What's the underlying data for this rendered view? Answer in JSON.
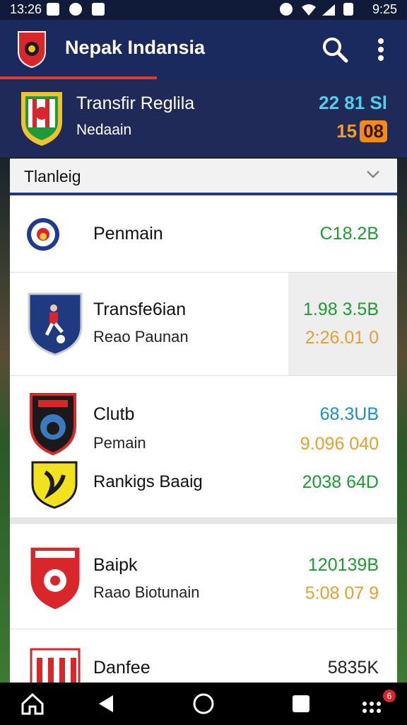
{
  "status": {
    "time_left": "13:26",
    "time_right": "9:25"
  },
  "app": {
    "title": "Nepak Indansia"
  },
  "featured": {
    "title": "Transfir Reglila",
    "subtitle": "Nedaain",
    "value_top": "22 81 Sl",
    "value_bottom_a": "15",
    "value_bottom_b": "08"
  },
  "dropdown": {
    "label": "Tlanleig"
  },
  "rows": [
    {
      "title": "Penmain",
      "value": "C18.2B"
    },
    {
      "title": "Transfe6ian",
      "subtitle": "Reao Paunan",
      "value_top": "1.98 3.5B",
      "value_bottom": "2:26.01 0"
    },
    {
      "title": "Clutb",
      "subtitle": "Pemain",
      "value_top": "68.3UB",
      "value_bottom": "9.096 040"
    },
    {
      "title": "Rankigs Baaig",
      "value": "2038 64D"
    },
    {
      "title": "Baipk",
      "subtitle": "Raao Biotunain",
      "value_top": "120139B",
      "value_bottom": "5:08 07 9"
    },
    {
      "title": "Danfee",
      "value": "5835K"
    }
  ],
  "nav": {
    "notif_count": "6"
  },
  "colors": {
    "app_bar": "#1b2a5e",
    "accent": "#e03b2c",
    "green": "#1e9a32",
    "orange": "#e8a030",
    "blue": "#1a8fd0"
  }
}
